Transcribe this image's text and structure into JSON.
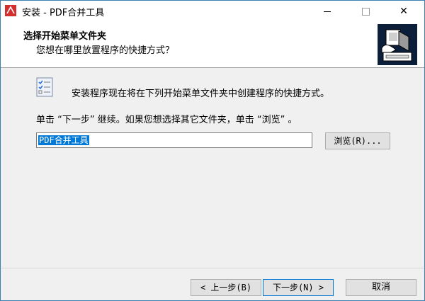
{
  "window": {
    "title": "安装 - PDF合并工具",
    "controls": {
      "minimize_icon": "minimize-icon",
      "maximize_icon": "maximize-icon",
      "close_glyph": "✕"
    }
  },
  "header": {
    "title": "选择开始菜单文件夹",
    "subtitle": "您想在哪里放置程序的快捷方式？"
  },
  "body": {
    "intro": "安装程序现在将在下列开始菜单文件夹中创建程序的快捷方式。",
    "hint": "单击 “下一步” 继续。如果您想选择其它文件夹，单击 “浏览” 。",
    "folder_value": "PDF合并工具",
    "browse_label": "浏览(R)..."
  },
  "footer": {
    "back_label": "< 上一步(B)",
    "next_label": "下一步(N) >",
    "cancel_label": "取消"
  },
  "colors": {
    "accent": "#0078d7",
    "app_icon": "#d32f2f"
  }
}
